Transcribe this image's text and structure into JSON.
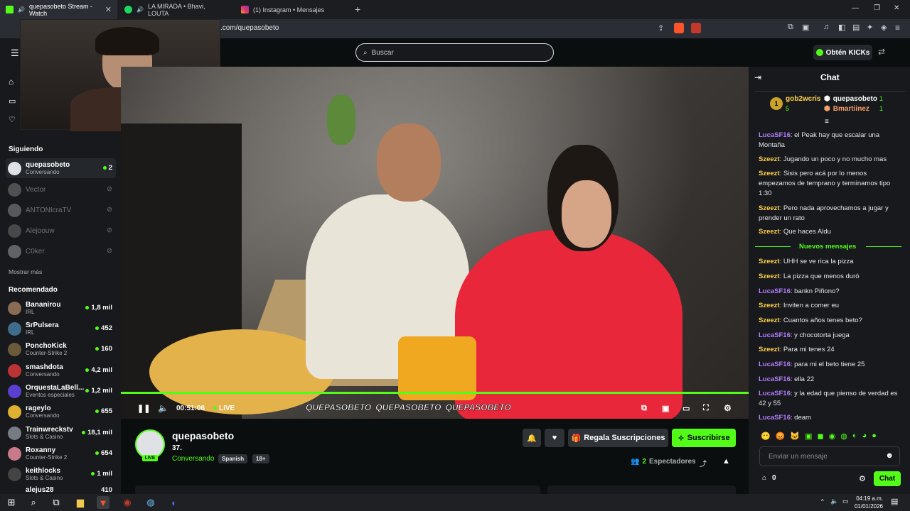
{
  "browser": {
    "tabs": [
      {
        "title": "quepasobeto Stream - Watch",
        "active": true,
        "color": "#53fc18"
      },
      {
        "title": "LA MIRADA • Bhavi, LOUTA",
        "active": false,
        "color": "#1ed760"
      },
      {
        "title": "(1) Instagram • Mensajes",
        "active": false,
        "color": "#e1306c"
      }
    ],
    "url": ".com/quepasobeto",
    "new_tab": "+",
    "window_controls": [
      "—",
      "❐",
      "✕"
    ]
  },
  "header": {
    "search_placeholder": "Buscar",
    "get_kicks": "Obtén KICKs"
  },
  "sidebar": {
    "following_title": "Siguiendo",
    "following": [
      {
        "name": "quepasobeto",
        "sub": "Conversando",
        "viewers": "2",
        "live": true
      },
      {
        "name": "Vector",
        "sub": "",
        "viewers": "",
        "live": false
      },
      {
        "name": "ANTONIcraTV",
        "sub": "",
        "viewers": "",
        "live": false
      },
      {
        "name": "Alejoouw",
        "sub": "",
        "viewers": "",
        "live": false
      },
      {
        "name": "C0ker",
        "sub": "",
        "viewers": "",
        "live": false
      }
    ],
    "show_more": "Mostrar más",
    "recommended_title": "Recomendado",
    "recommended": [
      {
        "name": "Bananirou",
        "sub": "IRL",
        "viewers": "1,8 mil"
      },
      {
        "name": "SrPulsera",
        "sub": "IRL",
        "viewers": "452"
      },
      {
        "name": "PonchoKick",
        "sub": "Counter-Strike 2",
        "viewers": "160"
      },
      {
        "name": "smashdota",
        "sub": "Conversando",
        "viewers": "4,2 mil"
      },
      {
        "name": "OrquestaLaBell...",
        "sub": "Eventos especiales",
        "viewers": "1,2 mil"
      },
      {
        "name": "rageylo",
        "sub": "Conversando",
        "viewers": "655"
      },
      {
        "name": "Trainwreckstv",
        "sub": "Slots & Casino",
        "viewers": "18,1 mil"
      },
      {
        "name": "Roxanny",
        "sub": "Counter-Strike 2",
        "viewers": "654"
      },
      {
        "name": "keithlocks",
        "sub": "Slots & Casino",
        "viewers": "1 mil"
      },
      {
        "name": "alejus28",
        "sub": "",
        "viewers": "410"
      }
    ]
  },
  "player": {
    "time": "00:51:06",
    "live_label": "LIVE",
    "overlay_handles": [
      "QUEPASOBETO",
      "QUEPASOBETO",
      "QUEPASOBETO"
    ]
  },
  "channel": {
    "name": "quepasobeto",
    "title": "37.",
    "category": "Conversando",
    "tags": [
      "Spanish",
      "18+"
    ],
    "live_badge": "LIVE",
    "gift_label": "Regala Suscripciones",
    "subscribe_label": "Suscribirse",
    "viewers_count": "2",
    "viewers_label": "Espectadores"
  },
  "chat": {
    "title": "Chat",
    "pinned": [
      {
        "rank": "1",
        "name": "gob2wcris",
        "count": "5"
      },
      {
        "rank": "",
        "name": "quepasobeto",
        "count": "1"
      },
      {
        "rank": "",
        "name": "Bmartiinez",
        "count": "1"
      }
    ],
    "messages_before": [
      {
        "user": "LucaSF16",
        "text": ": el Peak hay que escalar una Montaña"
      },
      {
        "user": "Szeezt",
        "text": ": Jugando un poco y no mucho mas"
      },
      {
        "user": "Szeezt",
        "text": ": Sisis pero acá por lo menos empezamos de temprano y terminamos tipo 1:30"
      },
      {
        "user": "Szeezt",
        "text": ": Pero nada aprovechamos a jugar y prender un rato"
      },
      {
        "user": "Szeezt",
        "text": ": Que haces Aldu"
      }
    ],
    "new_messages_label": "Nuevos mensajes",
    "messages_after": [
      {
        "user": "Szeezt",
        "text": ": UHH se ve rica la pizza"
      },
      {
        "user": "Szeezt",
        "text": ": La pizza que menos duró"
      },
      {
        "user": "LucaSF16",
        "text": ": bankn Piñono?"
      },
      {
        "user": "Szeezt",
        "text": ": Inviten a comer eu"
      },
      {
        "user": "Szeezt",
        "text": ": Cuantos años tenes beto?"
      },
      {
        "user": "LucaSF16",
        "text": ": y chocotorta juega"
      },
      {
        "user": "Szeezt",
        "text": ": Para mi tenes 24"
      },
      {
        "user": "LucaSF16",
        "text": ": para mi el beto tiene 25"
      },
      {
        "user": "LucaSF16",
        "text": ": ella 22"
      },
      {
        "user": "LucaSF16",
        "text": ": y la edad que pienso de verdad es 42 y 55"
      },
      {
        "user": "LucaSF16",
        "text": ": deam"
      }
    ],
    "input_placeholder": "Enviar un mensaje",
    "points": "0",
    "chat_button": "Chat"
  },
  "taskbar": {
    "time": "04:19 a.m.",
    "date": "01/01/2026"
  },
  "colors": {
    "accent": "#53fc18",
    "luca": "#b57dff",
    "szeezt": "#ffd24d"
  }
}
